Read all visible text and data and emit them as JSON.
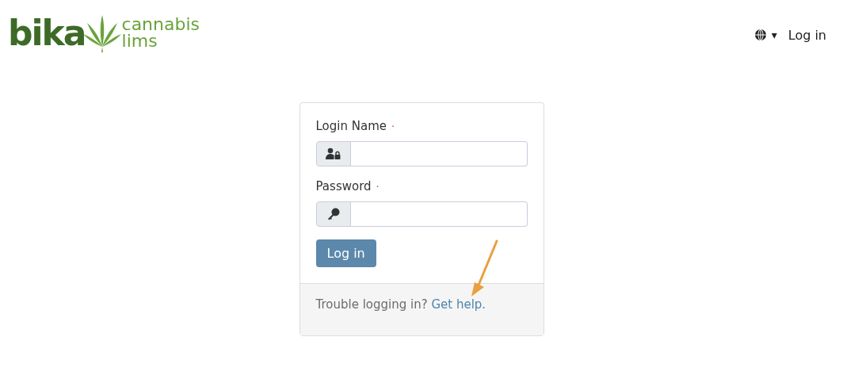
{
  "brand": {
    "wordmark": "bika",
    "tagline": [
      "cannabis",
      "lims"
    ]
  },
  "nav": {
    "language_caret": "▾",
    "login_link": "Log in"
  },
  "form": {
    "fields": [
      {
        "label": "Login Name",
        "required_mark": "·",
        "kind": "user-lock"
      },
      {
        "label": "Password",
        "required_mark": "·",
        "kind": "key"
      }
    ],
    "submit": "Log in",
    "footer": {
      "text": "Trouble logging in?",
      "link": "Get help."
    }
  }
}
